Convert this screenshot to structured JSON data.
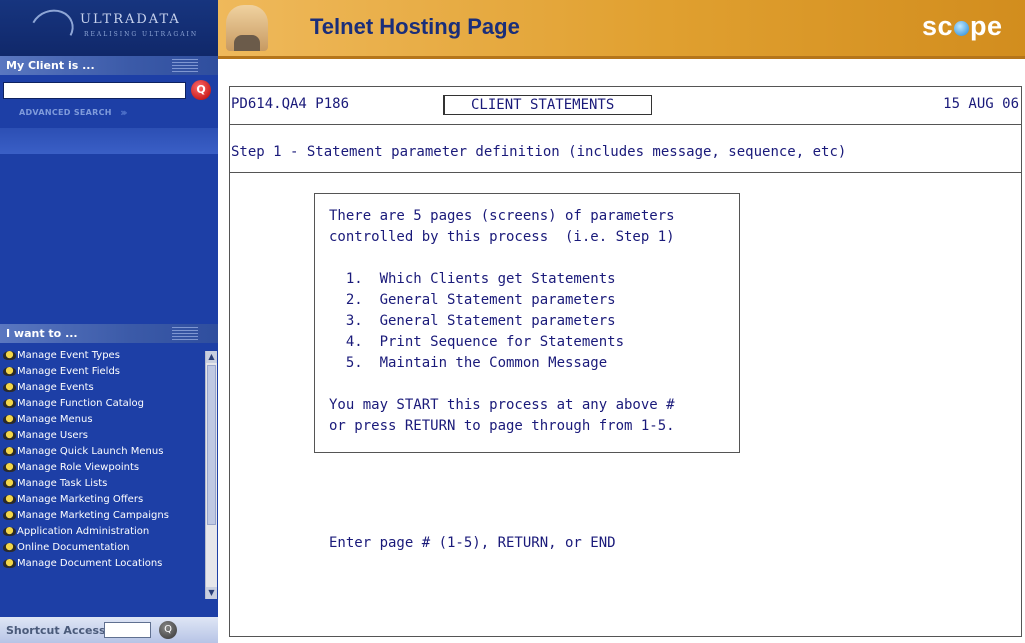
{
  "logo": {
    "name": "ULTRADATA",
    "tagline": "REALISING ULTRAGAIN"
  },
  "sidebar": {
    "my_client_title": "My Client is ...",
    "advanced_search": "ADVANCED SEARCH",
    "i_want_title": "I want to ...",
    "actions": [
      "Manage Event Types",
      "Manage Event Fields",
      "Manage Events",
      "Manage Function Catalog",
      "Manage Menus",
      "Manage Users",
      "Manage Quick Launch Menus",
      "Manage Role Viewpoints",
      "Manage Task Lists",
      "Manage Marketing Offers",
      "Manage Marketing Campaigns",
      "Application Administration",
      "Online Documentation",
      "Manage Document Locations"
    ],
    "shortcut_label": "Shortcut Access"
  },
  "header": {
    "title": "Telnet Hosting Page",
    "brand": {
      "pre": "sc",
      "post": "pe"
    }
  },
  "terminal": {
    "screen_id": "PD614.QA4 P186",
    "screen_title": "CLIENT STATEMENTS",
    "date": "15 AUG 06",
    "step_text": "Step 1 - Statement parameter definition (includes message, sequence, etc)",
    "info_lines": [
      "There are 5 pages (screens) of parameters",
      "controlled by this process  (i.e. Step 1)",
      "",
      "  1.  Which Clients get Statements",
      "  2.  General Statement parameters",
      "  3.  General Statement parameters",
      "  4.  Print Sequence for Statements",
      "  5.  Maintain the Common Message",
      "",
      "You may START this process at any above #",
      "or press RETURN to page through from 1-5."
    ],
    "prompt": "Enter page # (1-5), RETURN, or END"
  }
}
